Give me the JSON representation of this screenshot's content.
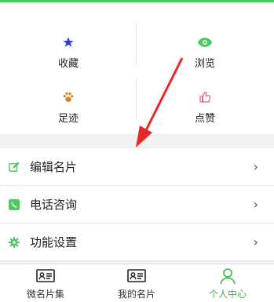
{
  "stats": [
    {
      "label": "收藏",
      "icon": "star-icon"
    },
    {
      "label": "浏览",
      "icon": "eye-icon"
    },
    {
      "label": "足迹",
      "icon": "paw-icon"
    },
    {
      "label": "点赞",
      "icon": "thumbs-up-icon"
    }
  ],
  "menu": [
    {
      "label": "编辑名片",
      "icon": "edit-icon"
    },
    {
      "label": "电话咨询",
      "icon": "phone-icon"
    },
    {
      "label": "功能设置",
      "icon": "gear-icon"
    }
  ],
  "tabs": [
    {
      "label": "微名片集",
      "icon": "card-icon"
    },
    {
      "label": "我的名片",
      "icon": "card-icon"
    },
    {
      "label": "个人中心",
      "icon": "person-icon",
      "active": true
    }
  ],
  "colors": {
    "accent": "#4cc864",
    "star": "#2e3fd1",
    "paw": "#e07a1f",
    "arrow": "#e52a2a"
  }
}
